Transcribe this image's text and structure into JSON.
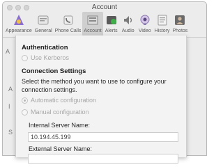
{
  "window": {
    "title": "Account"
  },
  "toolbar": {
    "items": [
      {
        "label": "Appearance",
        "icon": "appearance-icon"
      },
      {
        "label": "General",
        "icon": "general-icon"
      },
      {
        "label": "Phone Calls",
        "icon": "phone-calls-icon"
      },
      {
        "label": "Account",
        "icon": "account-icon",
        "active": true
      },
      {
        "label": "Alerts",
        "icon": "alerts-icon"
      },
      {
        "label": "Audio",
        "icon": "audio-icon"
      },
      {
        "label": "Video",
        "icon": "video-icon"
      },
      {
        "label": "History",
        "icon": "history-icon"
      },
      {
        "label": "Photos",
        "icon": "photos-icon"
      }
    ]
  },
  "background_pane": {
    "letters": [
      "A",
      "A",
      "I",
      "S"
    ]
  },
  "sheet": {
    "authentication": {
      "heading": "Authentication",
      "use_kerberos_label": "Use Kerberos",
      "use_kerberos_checked": false
    },
    "connection": {
      "heading": "Connection Settings",
      "description": "Select the method you want to use to configure your connection settings.",
      "options": [
        {
          "label": "Automatic configuration",
          "selected": true
        },
        {
          "label": "Manual configuration",
          "selected": false
        }
      ],
      "internal_server_label": "Internal Server Name:",
      "internal_server_value": "10.194.45.199",
      "external_server_label": "External Server Name:"
    }
  },
  "colors": {
    "window_bg": "#ececec",
    "sheet_bg": "#f3f3f3",
    "active_tab": "#cfcfcf"
  }
}
